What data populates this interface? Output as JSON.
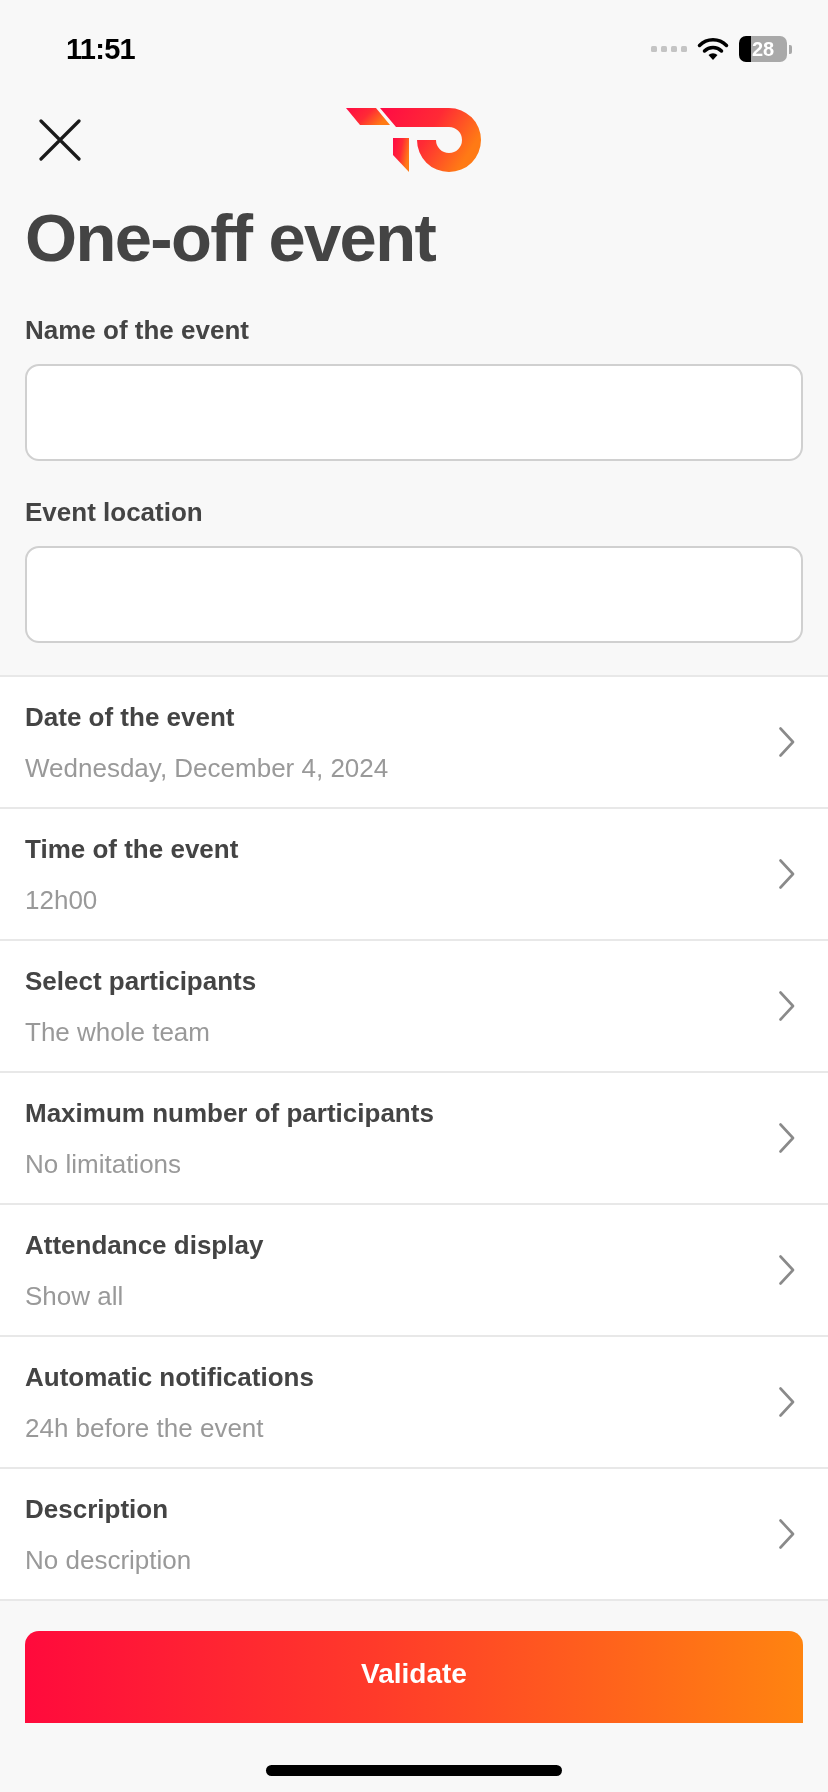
{
  "status_bar": {
    "time": "11:51",
    "battery": "28"
  },
  "header": {
    "title": "One-off event"
  },
  "fields": [
    {
      "label": "Name of the event"
    },
    {
      "label": "Event location"
    }
  ],
  "settings": [
    {
      "label": "Date of the event",
      "value": "Wednesday, December 4, 2024"
    },
    {
      "label": "Time of the event",
      "value": "12h00"
    },
    {
      "label": "Select participants",
      "value": "The whole team"
    },
    {
      "label": "Maximum number of participants",
      "value": "No limitations"
    },
    {
      "label": "Attendance display",
      "value": "Show all"
    },
    {
      "label": "Automatic notifications",
      "value": "24h before the event"
    },
    {
      "label": "Description",
      "value": "No description"
    }
  ],
  "validate_button": {
    "label": "Validate"
  }
}
